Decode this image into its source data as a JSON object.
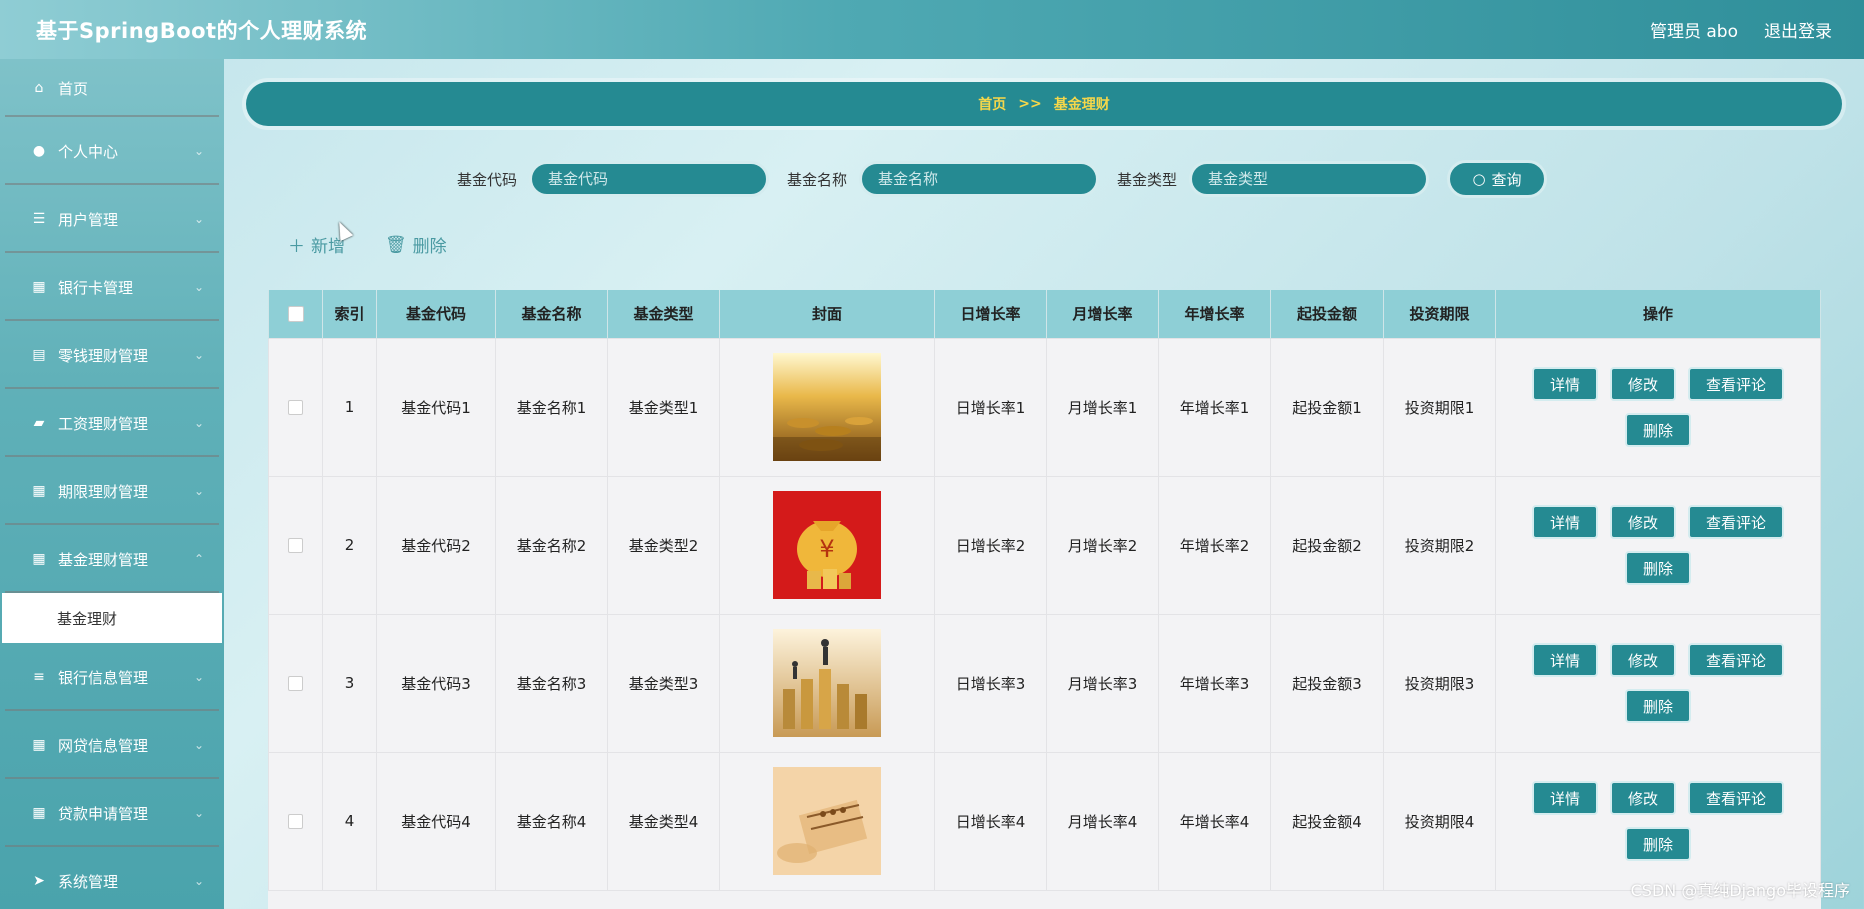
{
  "header": {
    "app_title": "基于SpringBoot的个人理财系统",
    "user_label": "管理员 abo",
    "logout_label": "退出登录"
  },
  "sidebar": {
    "items": [
      {
        "label": "首页",
        "icon": "home-icon"
      },
      {
        "label": "个人中心",
        "icon": "user-icon"
      },
      {
        "label": "用户管理",
        "icon": "sliders-icon"
      },
      {
        "label": "银行卡管理",
        "icon": "grid-icon"
      },
      {
        "label": "零钱理财管理",
        "icon": "clipboard-icon"
      },
      {
        "label": "工资理财管理",
        "icon": "ticket-icon"
      },
      {
        "label": "期限理财管理",
        "icon": "grid-icon"
      },
      {
        "label": "基金理财管理",
        "icon": "grid-icon"
      },
      {
        "label": "银行信息管理",
        "icon": "list-icon"
      },
      {
        "label": "网贷信息管理",
        "icon": "grid-icon"
      },
      {
        "label": "贷款申请管理",
        "icon": "grid-icon"
      },
      {
        "label": "系统管理",
        "icon": "send-icon"
      }
    ],
    "active_sub": "基金理财"
  },
  "breadcrumb": {
    "home": "首页",
    "sep": ">>",
    "current": "基金理财"
  },
  "search": {
    "code_label": "基金代码",
    "code_placeholder": "基金代码",
    "name_label": "基金名称",
    "name_placeholder": "基金名称",
    "type_label": "基金类型",
    "type_placeholder": "基金类型",
    "query_label": "查询"
  },
  "actions": {
    "add_label": "新增",
    "delete_label": "删除"
  },
  "table": {
    "headers": [
      "索引",
      "基金代码",
      "基金名称",
      "基金类型",
      "封面",
      "日增长率",
      "月增长率",
      "年增长率",
      "起投金额",
      "投资期限",
      "操作"
    ],
    "rows": [
      {
        "index": "1",
        "code": "基金代码1",
        "name": "基金名称1",
        "type": "基金类型1",
        "day": "日增长率1",
        "month": "月增长率1",
        "year": "年增长率1",
        "amount": "起投金额1",
        "term": "投资期限1"
      },
      {
        "index": "2",
        "code": "基金代码2",
        "name": "基金名称2",
        "type": "基金类型2",
        "day": "日增长率2",
        "month": "月增长率2",
        "year": "年增长率2",
        "amount": "起投金额2",
        "term": "投资期限2"
      },
      {
        "index": "3",
        "code": "基金代码3",
        "name": "基金名称3",
        "type": "基金类型3",
        "day": "日增长率3",
        "month": "月增长率3",
        "year": "年增长率3",
        "amount": "起投金额3",
        "term": "投资期限3"
      },
      {
        "index": "4",
        "code": "基金代码4",
        "name": "基金名称4",
        "type": "基金类型4",
        "day": "日增长率4",
        "month": "月增长率4",
        "year": "年增长率4",
        "amount": "起投金额4",
        "term": "投资期限4"
      }
    ],
    "ops": {
      "detail": "详情",
      "edit": "修改",
      "comments": "查看评论",
      "delete": "删除"
    }
  },
  "watermark": "CSDN @真纯Django毕设程序"
}
